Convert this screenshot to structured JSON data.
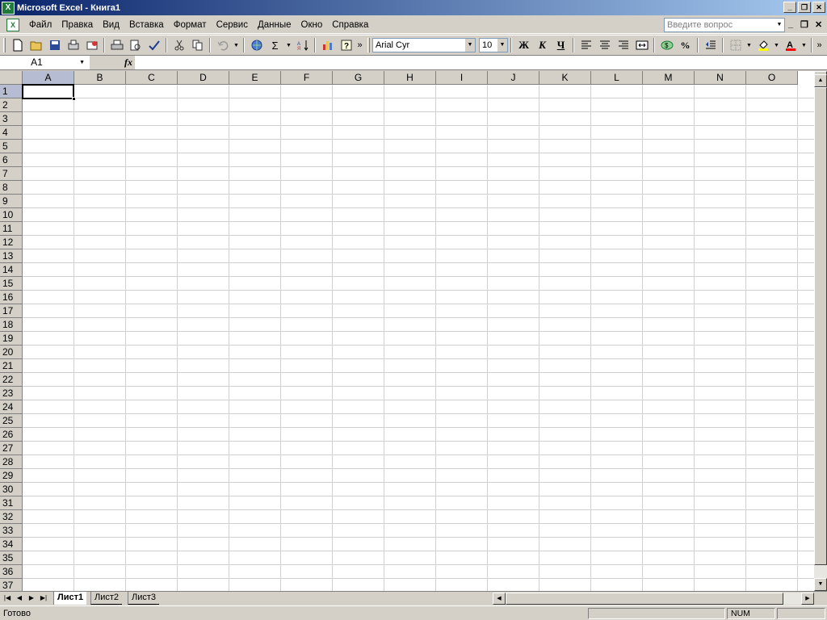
{
  "window": {
    "title": "Microsoft Excel - Книга1",
    "app_icon_glyph": "X",
    "min_label": "_",
    "restore_label": "❐",
    "close_label": "✕"
  },
  "menu": {
    "doc_icon_glyph": "X",
    "items": [
      "Файл",
      "Правка",
      "Вид",
      "Вставка",
      "Формат",
      "Сервис",
      "Данные",
      "Окно",
      "Справка"
    ],
    "help_placeholder": "Введите вопрос",
    "doc_min_label": "_",
    "doc_restore_label": "❐",
    "doc_close_label": "✕"
  },
  "toolbar": {
    "font_name": "Arial Cyr",
    "font_size": "10",
    "bold_label": "Ж",
    "italic_label": "К",
    "underline_label": "Ч",
    "sum_label": "Σ",
    "percent_label": "%",
    "overflow_label": "»"
  },
  "formula_bar": {
    "name_box": "A1",
    "fx_label": "fx",
    "content": ""
  },
  "grid": {
    "columns": [
      "A",
      "B",
      "C",
      "D",
      "E",
      "F",
      "G",
      "H",
      "I",
      "J",
      "K",
      "L",
      "M",
      "N",
      "O"
    ],
    "rows": [
      "1",
      "2",
      "3",
      "4",
      "5",
      "6",
      "7",
      "8",
      "9",
      "10",
      "11",
      "12",
      "13",
      "14",
      "15",
      "16",
      "17",
      "18",
      "19",
      "20",
      "21",
      "22",
      "23",
      "24",
      "25",
      "26",
      "27",
      "28",
      "29",
      "30",
      "31",
      "32",
      "33",
      "34",
      "35",
      "36",
      "37"
    ],
    "active_cell": "A1"
  },
  "sheets": {
    "tabs": [
      "Лист1",
      "Лист2",
      "Лист3"
    ],
    "active": "Лист1"
  },
  "status": {
    "text": "Готово",
    "num_indicator": "NUM"
  }
}
